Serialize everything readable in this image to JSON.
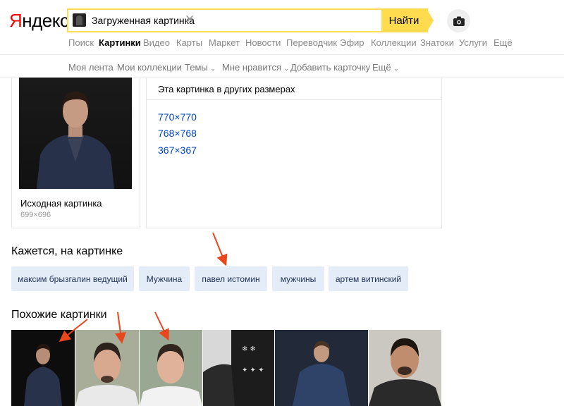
{
  "logo": {
    "first": "Я",
    "rest": "ндекс"
  },
  "search": {
    "query": "Загруженная картинка",
    "clear": "✕",
    "button": "Найти"
  },
  "services": [
    "Поиск",
    "Картинки",
    "Видео",
    "Карты",
    "Маркет",
    "Новости",
    "Переводчик",
    "Эфир",
    "Коллекции",
    "Знатоки",
    "Услуги",
    "Ещё"
  ],
  "subnav": [
    "Моя лента",
    "Мои коллекции",
    "Темы",
    "Мне нравится",
    "Добавить карточку",
    "Ещё"
  ],
  "original": {
    "title": "Исходная картинка",
    "size": "699×696"
  },
  "other_sizes": {
    "title": "Эта картинка в других размерах",
    "links": [
      "770×770",
      "768×768",
      "367×367"
    ]
  },
  "tags_section": {
    "title": "Кажется, на картинке",
    "tags": [
      "максим брызгалин ведущий",
      "Мужчина",
      "павел истомин",
      "мужчины",
      "артем витинский"
    ]
  },
  "similar": {
    "title": "Похожие картинки"
  },
  "colors": {
    "accent": "#ffdb4d",
    "arrow": "#e8461c",
    "link": "#0044bb"
  }
}
